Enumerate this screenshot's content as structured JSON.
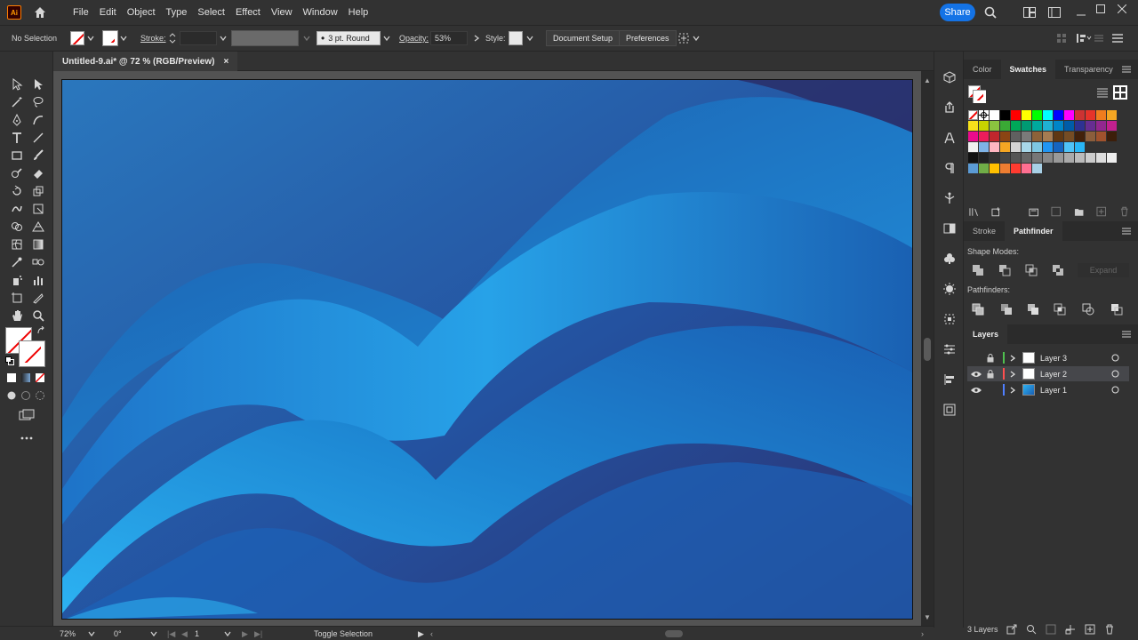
{
  "menubar": {
    "app_logo": "Ai",
    "items": [
      "File",
      "Edit",
      "Object",
      "Type",
      "Select",
      "Effect",
      "View",
      "Window",
      "Help"
    ],
    "share_label": "Share"
  },
  "controlbar": {
    "selection_label": "No Selection",
    "stroke_label": "Stroke:",
    "brush_value": "3 pt. Round",
    "opacity_label": "Opacity:",
    "opacity_value": "53%",
    "style_label": "Style:",
    "document_setup_label": "Document Setup",
    "preferences_label": "Preferences"
  },
  "document": {
    "tab_title": "Untitled-9.ai* @ 72 % (RGB/Preview)",
    "close_glyph": "×"
  },
  "panels": {
    "color_tabs": [
      "Color",
      "Swatches",
      "Transparency"
    ],
    "active_color_tab": "Swatches",
    "stroke_tabs": [
      "Stroke",
      "Pathfinder"
    ],
    "active_stroke_tab": "Pathfinder",
    "shape_modes_label": "Shape Modes:",
    "expand_label": "Expand",
    "pathfinders_label": "Pathfinders:",
    "layers_tab": "Layers",
    "layers": [
      {
        "name": "Layer 3",
        "color": "#4fc04f",
        "visible": false,
        "selected": false
      },
      {
        "name": "Layer 2",
        "color": "#ff4f4f",
        "visible": true,
        "selected": true
      },
      {
        "name": "Layer 1",
        "color": "#4f7fff",
        "visible": true,
        "selected": false
      }
    ],
    "layers_count": "3 Layers"
  },
  "statusbar": {
    "zoom": "72%",
    "rotation": "0°",
    "artboard_number": "1",
    "status_text": "Toggle Selection"
  },
  "colors": {
    "accent": "#1473e6",
    "ui_bg": "#323232",
    "artboard_blue": "#2b66b3",
    "artboard_dark": "#2b2f6e",
    "ribbon_light": "#2cb0f0"
  }
}
